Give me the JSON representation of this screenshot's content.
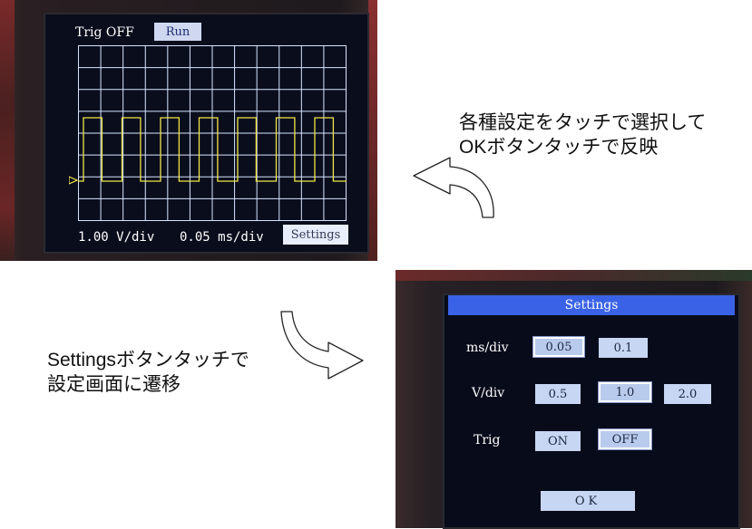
{
  "scope_screen": {
    "trig_status": "Trig OFF",
    "run_label": "Run",
    "volts_per_div": "1.00 V/div",
    "time_per_div": "0.05 ms/div",
    "settings_label": "Settings",
    "grid_color": "#d6e6ff",
    "trace_color": "#f2e64a"
  },
  "annotations": {
    "top_line1": "各種設定をタッチで選択して",
    "top_line2": "OKボタンタッチで反映",
    "bottom_line1": "Settingsボタンタッチで",
    "bottom_line2": "設定画面に遷移"
  },
  "settings_screen": {
    "title": "Settings",
    "header_color": "#3a62e6",
    "rows": [
      {
        "label": "ms/div",
        "options": [
          "0.05",
          "0.1"
        ],
        "selected": "0.05"
      },
      {
        "label": "V/div",
        "options": [
          "0.5",
          "1.0",
          "2.0"
        ],
        "selected": "1.0"
      },
      {
        "label": "Trig",
        "options": [
          "ON",
          "OFF"
        ],
        "selected": "OFF"
      }
    ],
    "ok_label": "OK"
  }
}
